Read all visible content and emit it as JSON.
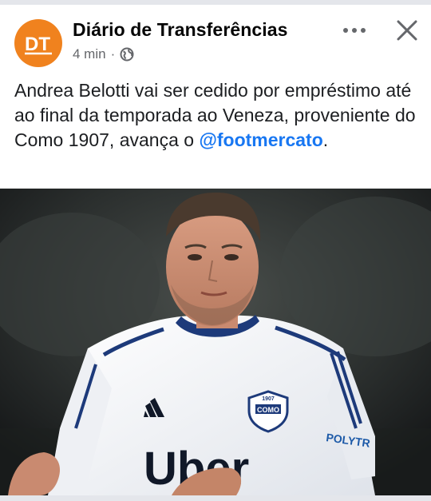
{
  "post": {
    "page_name": "Diário de Transferências",
    "avatar_initials": "DT",
    "time": "4 min",
    "separator": "·",
    "privacy_icon": "globe-icon",
    "more_icon": "more-icon",
    "close_icon": "close-icon",
    "text_main": "Andrea Belotti vai ser cedido por empréstimo até ao final da temporada ao Veneza, proveniente do Como 1907, avança o ",
    "mention": "@footmercato",
    "text_end": "."
  },
  "photo": {
    "shirt_sponsor": "Uber",
    "crest_year": "1907",
    "crest_name": "COMO",
    "sleeve_sponsor": "POLYTR"
  },
  "colors": {
    "avatar": "#f0821e",
    "mention": "#1877f2",
    "meta_text": "#65676b",
    "shirt_trim": "#1d3a7a"
  }
}
